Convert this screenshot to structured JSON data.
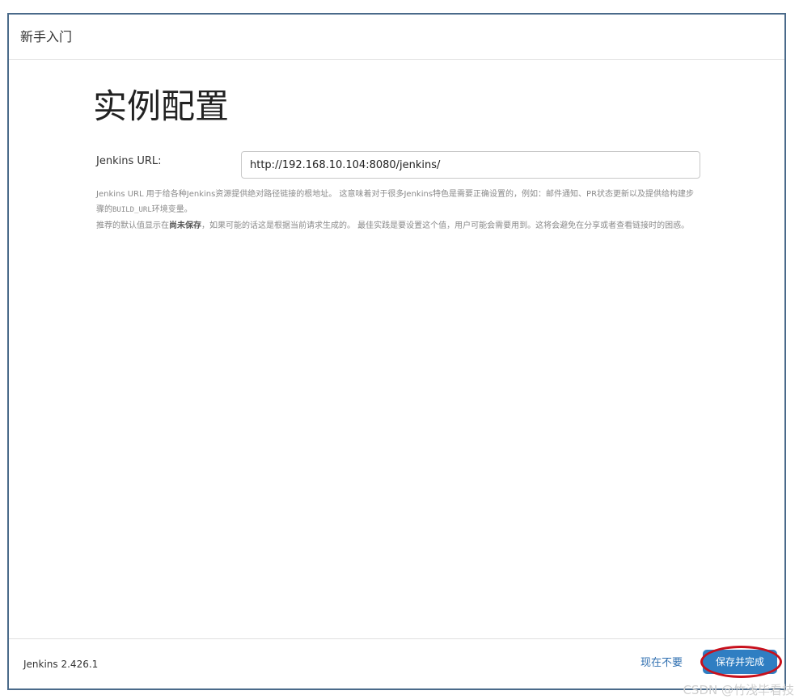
{
  "header": {
    "title": "新手入门"
  },
  "main": {
    "title": "实例配置",
    "url_label": "Jenkins URL:",
    "url_value": "http://192.168.10.104:8080/jenkins/",
    "help": {
      "line1_a": "Jenkins URL 用于给各种Jenkins资源提供绝对路径链接的根地址。 这意味着对于很多Jenkins特色是需要正确设置的，例如：邮件通知、PR状态更新以及提供给构建步骤的",
      "line1_code": "BUILD_URL",
      "line1_b": "环境变量。",
      "line2_a": "推荐的默认值显示在",
      "line2_strong": "尚未保存",
      "line2_b": "，如果可能的话这是根据当前请求生成的。 最佳实践是要设置这个值，用户可能会需要用到。这将会避免在分享或者查看链接时的困惑。"
    }
  },
  "footer": {
    "version": "Jenkins 2.426.1",
    "skip_label": "现在不要",
    "save_label": "保存并完成"
  },
  "watermark": "CSDN @竹浅毕看技",
  "colors": {
    "accent": "#2f7ec2",
    "link": "#2f6fb0",
    "highlight": "#c8101c",
    "frame_border": "#4a6a8a"
  }
}
